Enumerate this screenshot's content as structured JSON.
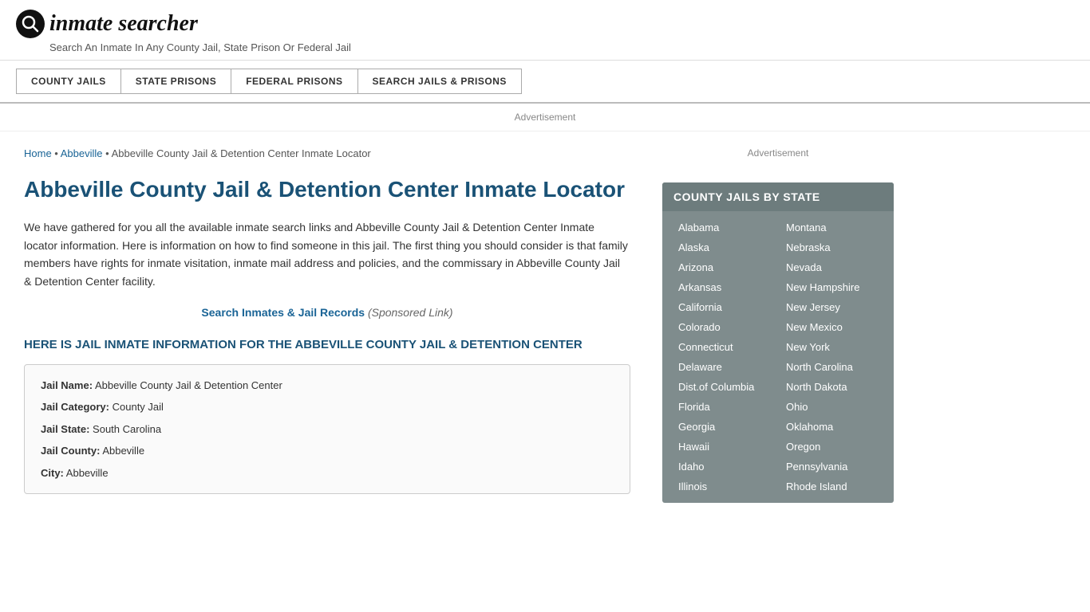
{
  "header": {
    "logo_icon": "🔍",
    "logo_text": "inmate searcher",
    "tagline": "Search An Inmate In Any County Jail, State Prison Or Federal Jail"
  },
  "nav": {
    "items": [
      {
        "label": "COUNTY JAILS"
      },
      {
        "label": "STATE PRISONS"
      },
      {
        "label": "FEDERAL PRISONS"
      },
      {
        "label": "SEARCH JAILS & PRISONS"
      }
    ]
  },
  "ad_label": "Advertisement",
  "breadcrumb": {
    "home": "Home",
    "separator1": " • ",
    "abbeville_link": "Abbeville",
    "separator2": " • ",
    "current": "Abbeville County Jail & Detention Center Inmate Locator"
  },
  "page_title": "Abbeville County Jail & Detention Center Inmate Locator",
  "body_text": "We have gathered for you all the available inmate search links and Abbeville County Jail & Detention Center Inmate locator information. Here is information on how to find someone in this jail. The first thing you should consider is that family members have rights for inmate visitation, inmate mail address and policies, and the commissary in Abbeville County Jail & Detention Center facility.",
  "search_link_text": "Search Inmates & Jail Records",
  "sponsored_text": "(Sponsored Link)",
  "section_heading": "HERE IS JAIL INMATE INFORMATION FOR THE ABBEVILLE COUNTY JAIL & DETENTION CENTER",
  "jail_info": {
    "name_label": "Jail Name:",
    "name_value": "Abbeville County Jail & Detention Center",
    "category_label": "Jail Category:",
    "category_value": "County Jail",
    "state_label": "Jail State:",
    "state_value": "South Carolina",
    "county_label": "Jail County:",
    "county_value": "Abbeville",
    "city_label": "City:",
    "city_value": "Abbeville"
  },
  "sidebar": {
    "ad_label": "Advertisement",
    "state_box_title": "COUNTY JAILS BY STATE",
    "states_left": [
      "Alabama",
      "Alaska",
      "Arizona",
      "Arkansas",
      "California",
      "Colorado",
      "Connecticut",
      "Delaware",
      "Dist.of Columbia",
      "Florida",
      "Georgia",
      "Hawaii",
      "Idaho",
      "Illinois"
    ],
    "states_right": [
      "Montana",
      "Nebraska",
      "Nevada",
      "New Hampshire",
      "New Jersey",
      "New Mexico",
      "New York",
      "North Carolina",
      "North Dakota",
      "Ohio",
      "Oklahoma",
      "Oregon",
      "Pennsylvania",
      "Rhode Island"
    ]
  }
}
